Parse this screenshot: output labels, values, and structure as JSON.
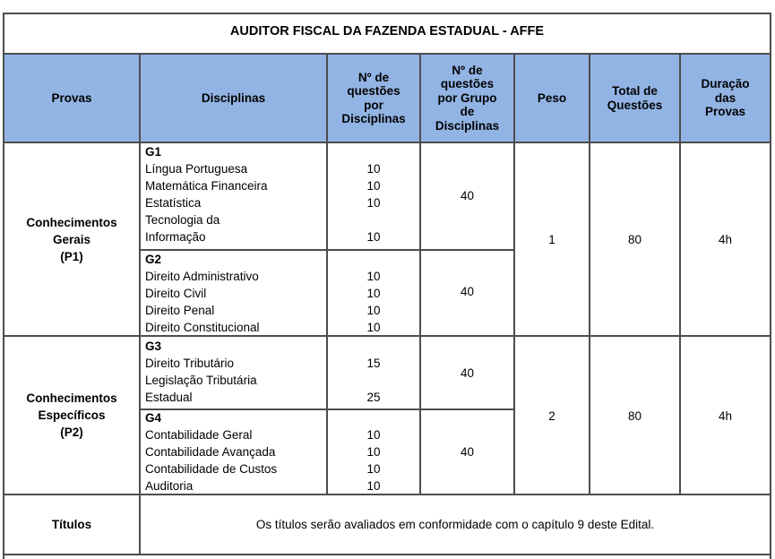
{
  "title": "AUDITOR FISCAL DA FAZENDA ESTADUAL - AFFE",
  "colors": {
    "header_bg": "#92b4e4",
    "border": "#4d4d4d"
  },
  "headers": {
    "provas": "Provas",
    "disciplinas": "Disciplinas",
    "q_disc": [
      "Nº de",
      "questões",
      "por",
      "Disciplinas"
    ],
    "q_grupo": [
      "Nº de",
      "questões",
      "por Grupo",
      "de",
      "Disciplinas"
    ],
    "peso": "Peso",
    "total": [
      "Total de",
      "Questões"
    ],
    "duracao": [
      "Duração",
      "das",
      "Provas"
    ]
  },
  "p1": {
    "name": [
      "Conhecimentos",
      "Gerais",
      "(P1)"
    ],
    "peso": "1",
    "total": "80",
    "duracao": "4h",
    "g1": {
      "label": "G1",
      "lines": [
        "Língua Portuguesa",
        "Matemática Financeira",
        "Estatística",
        "Tecnologia da",
        "Informação"
      ],
      "counts": [
        "10",
        "10",
        "10",
        "",
        "10"
      ],
      "group_total": "40"
    },
    "g2": {
      "label": "G2",
      "lines": [
        "Direito Administrativo",
        "Direito Civil",
        "Direito Penal",
        "Direito Constitucional"
      ],
      "counts": [
        "10",
        "10",
        "10",
        "10"
      ],
      "group_total": "40"
    }
  },
  "p2": {
    "name": [
      "Conhecimentos",
      "Específicos",
      "(P2)"
    ],
    "peso": "2",
    "total": "80",
    "duracao": "4h",
    "g3": {
      "label": "G3",
      "lines": [
        "Direito Tributário",
        "Legislação Tributária",
        "Estadual"
      ],
      "counts": [
        "15",
        "",
        "25"
      ],
      "group_total": "40"
    },
    "g4": {
      "label": "G4",
      "lines": [
        "Contabilidade Geral",
        "Contabilidade Avançada",
        "Contabilidade de Custos",
        "Auditoria"
      ],
      "counts": [
        "10",
        "10",
        "10",
        "10"
      ],
      "group_total": "40"
    }
  },
  "titulos": {
    "label": "Títulos",
    "text": "Os títulos serão avaliados em conformidade com o capítulo 9 deste Edital."
  }
}
